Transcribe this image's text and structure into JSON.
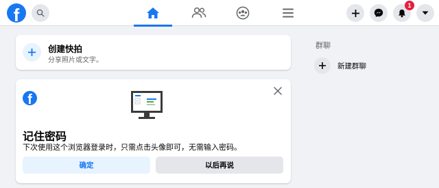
{
  "header": {
    "logo_letter": "f",
    "notification_count": "1",
    "tabs": [
      {
        "name": "home",
        "active": true
      },
      {
        "name": "friends",
        "active": false
      },
      {
        "name": "groups",
        "active": false
      },
      {
        "name": "menu",
        "active": false
      }
    ],
    "icons": [
      "search-icon",
      "home-icon",
      "friends-icon",
      "groups-icon",
      "menu-icon",
      "plus-icon",
      "messenger-icon",
      "bell-icon",
      "caret-down-icon"
    ]
  },
  "create_story": {
    "title": "创建快拍",
    "subtitle": "分享照片或文字。"
  },
  "save_password": {
    "logo_letter": "f",
    "title": "记住密码",
    "description": "下次使用这个浏览器登录时，只需点击头像即可，无需输入密码。",
    "confirm_label": "确定",
    "later_label": "以后再说"
  },
  "sidebar": {
    "groups_heading": "群聊",
    "new_group_label": "新建群聊"
  },
  "colors": {
    "brand": "#1877f2",
    "badge": "#e41e3f",
    "background": "#f0f2f5"
  }
}
